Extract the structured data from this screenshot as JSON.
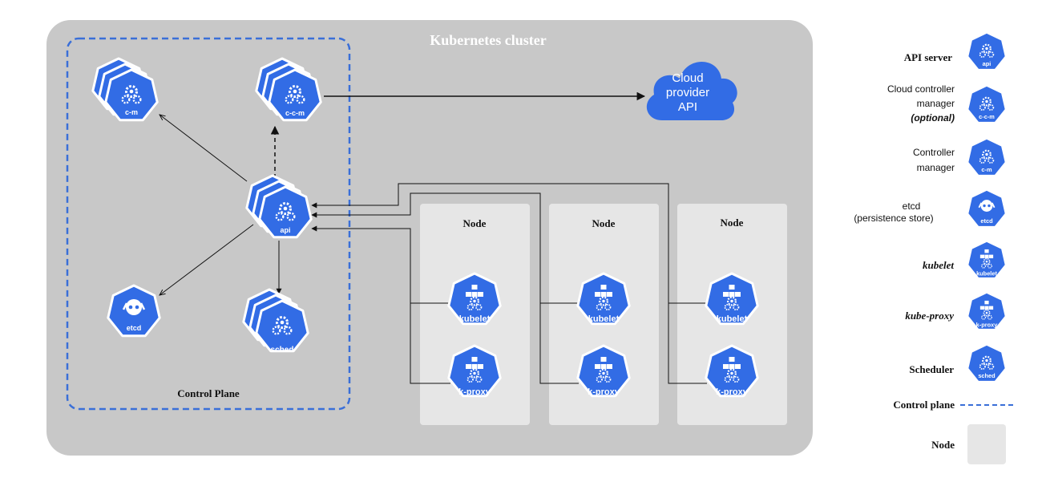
{
  "cluster": {
    "title": "Kubernetes cluster"
  },
  "control_plane": {
    "label": "Control Plane"
  },
  "cloud": {
    "line1": "Cloud",
    "line2": "provider",
    "line3": "API"
  },
  "components": {
    "cm": "c-m",
    "ccm": "c-c-m",
    "api": "api",
    "etcd": "etcd",
    "sched": "sched"
  },
  "nodes": [
    {
      "title": "Node",
      "kubelet": "kubelet",
      "kproxy": "k-proxy"
    },
    {
      "title": "Node",
      "kubelet": "kubelet",
      "kproxy": "k-proxy"
    },
    {
      "title": "Node",
      "kubelet": "kubelet",
      "kproxy": "k-proxy"
    }
  ],
  "legend": {
    "api_server": {
      "label": "API server",
      "icon": "api"
    },
    "ccm": {
      "line1": "Cloud controller",
      "line2": "manager",
      "line3": "(optional)",
      "icon": "c-c-m"
    },
    "cm": {
      "line1": "Controller",
      "line2": "manager",
      "icon": "c-m"
    },
    "etcd": {
      "line1": "etcd",
      "line2": "(persistence store)",
      "icon": "etcd"
    },
    "kubelet": {
      "label": "kubelet",
      "icon": "kubelet"
    },
    "kproxy": {
      "label": "kube-proxy",
      "icon": "k-proxy"
    },
    "scheduler": {
      "label": "Scheduler",
      "icon": "sched"
    },
    "control_plane": {
      "label": "Control plane"
    },
    "node": {
      "label": "Node"
    }
  },
  "colors": {
    "k8s_blue": "#326CE5",
    "cluster_bg": "#C8C8C8",
    "node_bg": "#E6E6E6",
    "control_plane_border": "#3A6FD8"
  }
}
